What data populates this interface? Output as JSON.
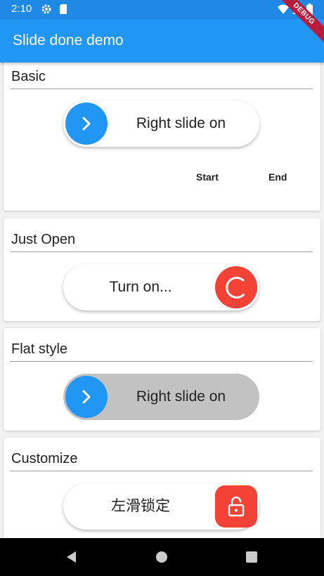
{
  "status_bar": {
    "time": "2:10",
    "icons": [
      "gear-icon",
      "sd-card-icon",
      "wifi-icon",
      "signal-icon",
      "battery-icon"
    ]
  },
  "app_bar": {
    "title": "Slide done demo"
  },
  "debug_banner": {
    "label": "DEBUG"
  },
  "cards": {
    "basic": {
      "title": "Basic",
      "slider_label": "Right slide on",
      "start_label": "Start",
      "end_label": "End"
    },
    "just_open": {
      "title": "Just Open",
      "slider_label": "Turn on..."
    },
    "flat_style": {
      "title": "Flat style",
      "slider_label": "Right slide on"
    },
    "customize": {
      "title": "Customize",
      "slider_label": "左滑锁定"
    }
  },
  "colors": {
    "primary": "#2196f3",
    "status_bar": "#1e88e5",
    "accent_red": "#f44336",
    "flat_track": "#c2c2c2"
  }
}
